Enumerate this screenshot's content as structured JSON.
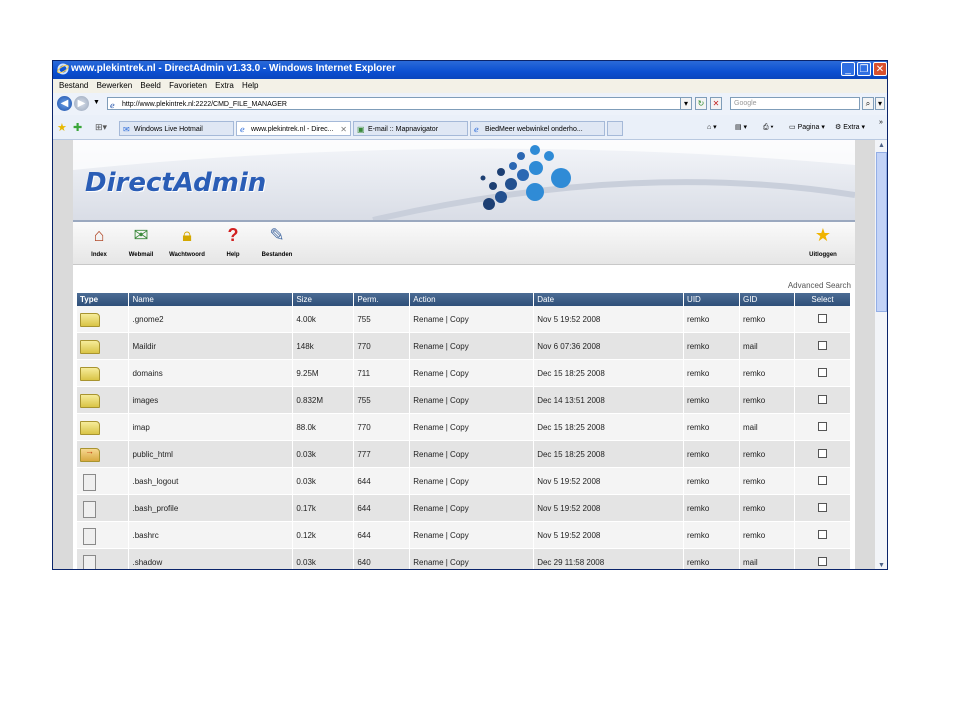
{
  "window": {
    "title": "www.plekintrek.nl - DirectAdmin v1.33.0 - Windows Internet Explorer",
    "buttons": [
      "_",
      "❐",
      "✕"
    ]
  },
  "menu": [
    "Bestand",
    "Bewerken",
    "Beeld",
    "Favorieten",
    "Extra",
    "Help"
  ],
  "address": {
    "url": "http://www.plekintrek.nl:2222/CMD_FILE_MANAGER",
    "search_placeholder": "Google"
  },
  "tabs": [
    {
      "label": "Windows Live Hotmail",
      "active": false
    },
    {
      "label": "www.plekintrek.nl - Direc...",
      "active": true
    },
    {
      "label": "E-mail :: Mapnavigator",
      "active": false
    },
    {
      "label": "BiedMeer webwinkel onderho...",
      "active": false
    }
  ],
  "tools": {
    "page": "Pagina",
    "extra": "Extra"
  },
  "brand": {
    "logo": "DirectAdmin"
  },
  "nav": {
    "index": "Index",
    "webmail": "Webmail",
    "wachtwoord": "Wachtwoord",
    "help": "Help",
    "bestanden": "Bestanden",
    "uitloggen": "Uitloggen"
  },
  "advanced_search": "Advanced Search",
  "table": {
    "headers": [
      "Type",
      "Name",
      "Size",
      "Perm.",
      "Action",
      "Date",
      "UID",
      "GID",
      "Select"
    ],
    "rows": [
      {
        "type": "folder",
        "name": ".gnome2",
        "size": "4.00k",
        "perm": "755",
        "action": "Rename | Copy",
        "date": "Nov 5 19:52 2008",
        "uid": "remko",
        "gid": "remko"
      },
      {
        "type": "folder",
        "name": "Maildir",
        "size": "148k",
        "perm": "770",
        "action": "Rename | Copy",
        "date": "Nov 6 07:36 2008",
        "uid": "remko",
        "gid": "mail"
      },
      {
        "type": "folder",
        "name": "domains",
        "size": "9.25M",
        "perm": "711",
        "action": "Rename | Copy",
        "date": "Dec 15 18:25 2008",
        "uid": "remko",
        "gid": "remko"
      },
      {
        "type": "folder",
        "name": "images",
        "size": "0.832M",
        "perm": "755",
        "action": "Rename | Copy",
        "date": "Dec 14 13:51 2008",
        "uid": "remko",
        "gid": "remko"
      },
      {
        "type": "folder",
        "name": "imap",
        "size": "88.0k",
        "perm": "770",
        "action": "Rename | Copy",
        "date": "Dec 15 18:25 2008",
        "uid": "remko",
        "gid": "mail"
      },
      {
        "type": "folder-link",
        "name": "public_html",
        "size": "0.03k",
        "perm": "777",
        "action": "Rename | Copy",
        "date": "Dec 15 18:25 2008",
        "uid": "remko",
        "gid": "remko"
      },
      {
        "type": "file",
        "name": ".bash_logout",
        "size": "0.03k",
        "perm": "644",
        "action": "Rename | Copy",
        "date": "Nov 5 19:52 2008",
        "uid": "remko",
        "gid": "remko"
      },
      {
        "type": "file",
        "name": ".bash_profile",
        "size": "0.17k",
        "perm": "644",
        "action": "Rename | Copy",
        "date": "Nov 5 19:52 2008",
        "uid": "remko",
        "gid": "remko"
      },
      {
        "type": "file",
        "name": ".bashrc",
        "size": "0.12k",
        "perm": "644",
        "action": "Rename | Copy",
        "date": "Nov 5 19:52 2008",
        "uid": "remko",
        "gid": "remko"
      },
      {
        "type": "file",
        "name": ".shadow",
        "size": "0.03k",
        "perm": "640",
        "action": "Rename | Copy",
        "date": "Dec 29 11:58 2008",
        "uid": "remko",
        "gid": "mail"
      }
    ]
  }
}
